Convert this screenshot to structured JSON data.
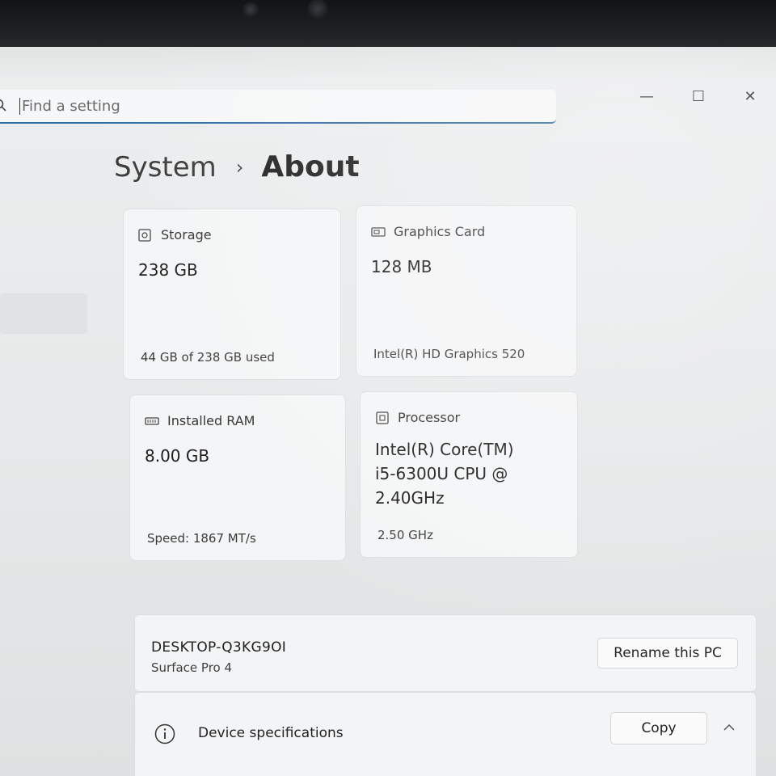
{
  "search": {
    "placeholder": "Find a setting"
  },
  "window_controls": {
    "minimize": "—",
    "maximize": "☐",
    "close": "✕"
  },
  "breadcrumb": {
    "parent": "System",
    "separator": "›",
    "current": "About"
  },
  "cards": {
    "storage": {
      "label": "Storage",
      "value": "238 GB",
      "sub": "44 GB of 238 GB used"
    },
    "graphics": {
      "label": "Graphics Card",
      "value": "128 MB",
      "sub": "Intel(R) HD Graphics 520"
    },
    "ram": {
      "label": "Installed RAM",
      "value": "8.00 GB",
      "sub": "Speed: 1867 MT/s"
    },
    "processor": {
      "label": "Processor",
      "value_lines": [
        "Intel(R) Core(TM)",
        "i5-6300U CPU @",
        "2.40GHz"
      ],
      "sub": "2.50 GHz"
    }
  },
  "pc": {
    "name": "DESKTOP-Q3KG9OI",
    "model": "Surface Pro 4",
    "rename_label": "Rename this PC"
  },
  "device_specs": {
    "label": "Device specifications",
    "copy_label": "Copy"
  },
  "colors": {
    "accent": "#2e6da8",
    "card_bg": "#f4f5f6",
    "page_bg": "#eceeef"
  }
}
